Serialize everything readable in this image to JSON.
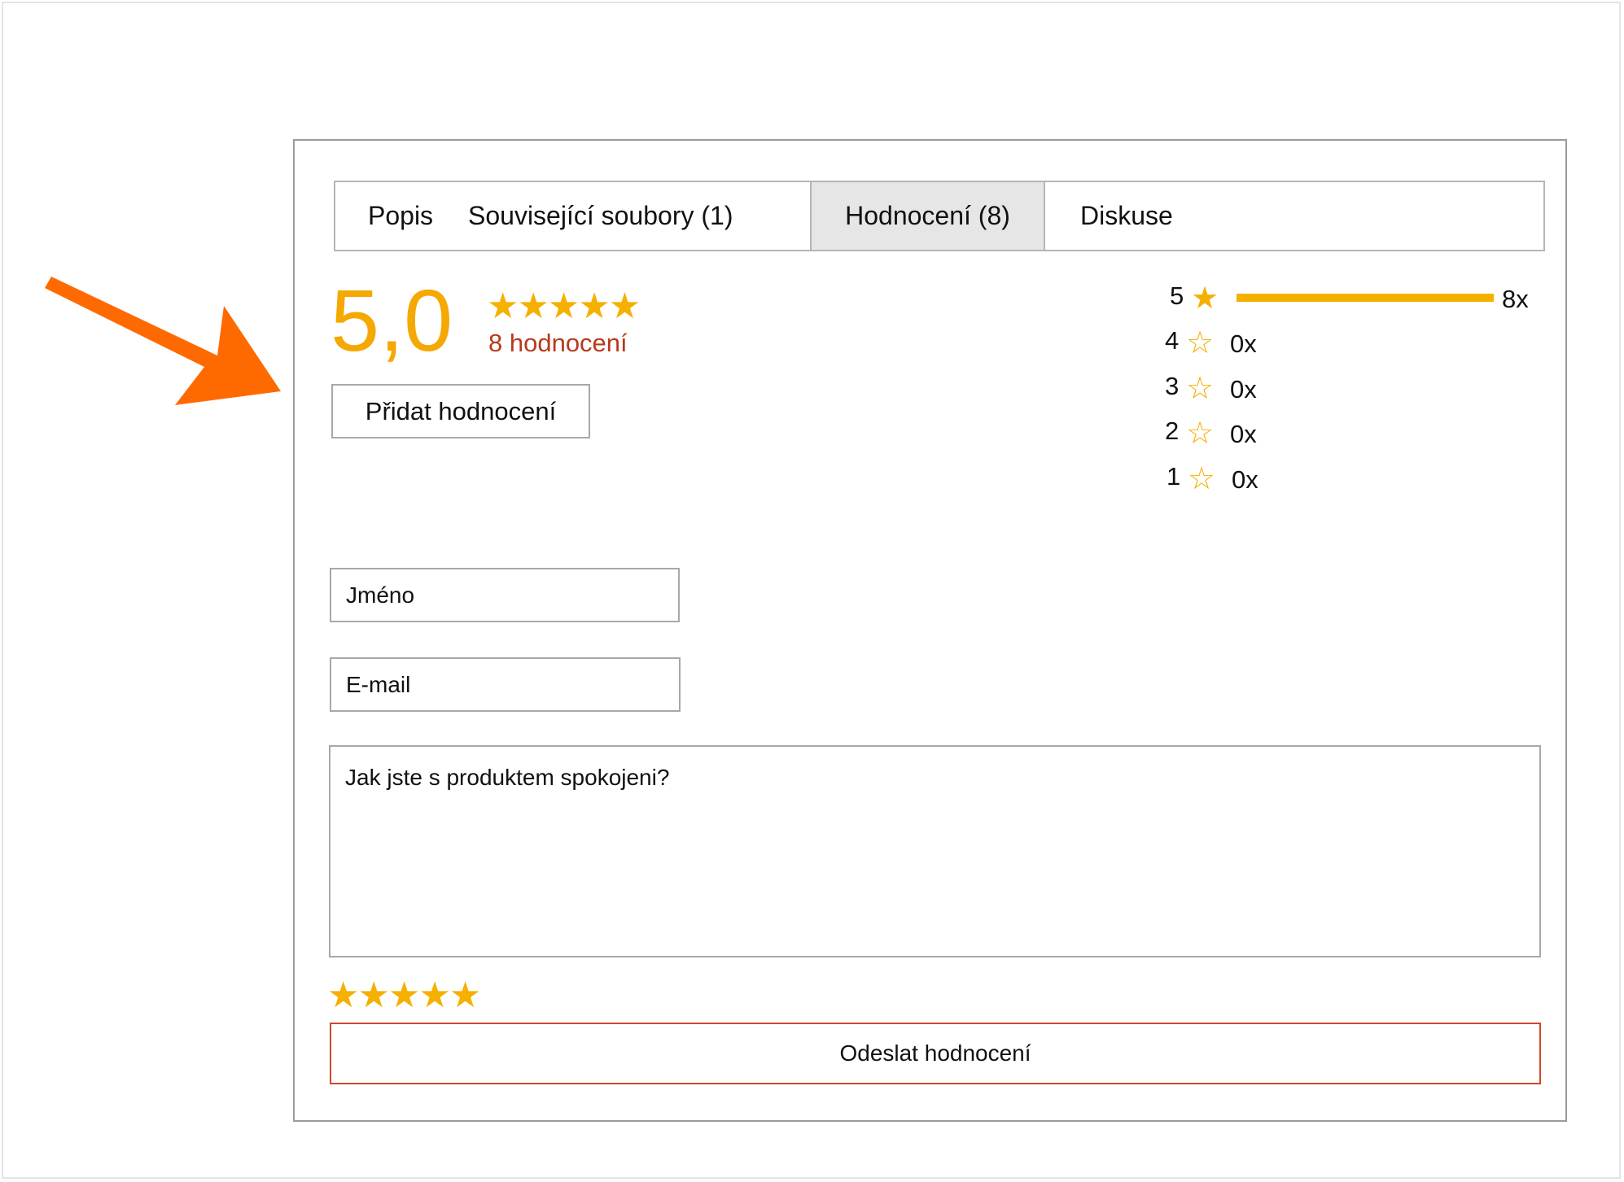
{
  "tabs": [
    {
      "label": "Popis"
    },
    {
      "label": "Související soubory (1)"
    },
    {
      "label": "Hodnocení (8)",
      "active": true
    },
    {
      "label": "Diskuse"
    }
  ],
  "summary": {
    "average": "5,0",
    "stars": "★★★★★",
    "count_label": "8 hodnocení",
    "add_button_label": "Přidat hodnocení"
  },
  "distribution": [
    {
      "stars": "5",
      "icon": "★",
      "count": "8x",
      "fraction": 1.0
    },
    {
      "stars": "4",
      "icon": "☆",
      "count": "0x",
      "fraction": 0
    },
    {
      "stars": "3",
      "icon": "☆",
      "count": "0x",
      "fraction": 0
    },
    {
      "stars": "2",
      "icon": "☆",
      "count": "0x",
      "fraction": 0
    },
    {
      "stars": "1",
      "icon": "☆",
      "count": "0x",
      "fraction": 0
    }
  ],
  "form": {
    "name_placeholder": "Jméno",
    "email_placeholder": "E-mail",
    "message_placeholder": "Jak jste s produktem spokojeni?",
    "rating_stars": [
      "★",
      "★",
      "★",
      "★",
      "★"
    ],
    "submit_label": "Odeslat hodnocení"
  },
  "colors": {
    "accent": "#f5a900",
    "star": "#f5b000",
    "count_text": "#b83a1b",
    "submit_border": "#d2462a",
    "arrow": "#ff6a00"
  }
}
